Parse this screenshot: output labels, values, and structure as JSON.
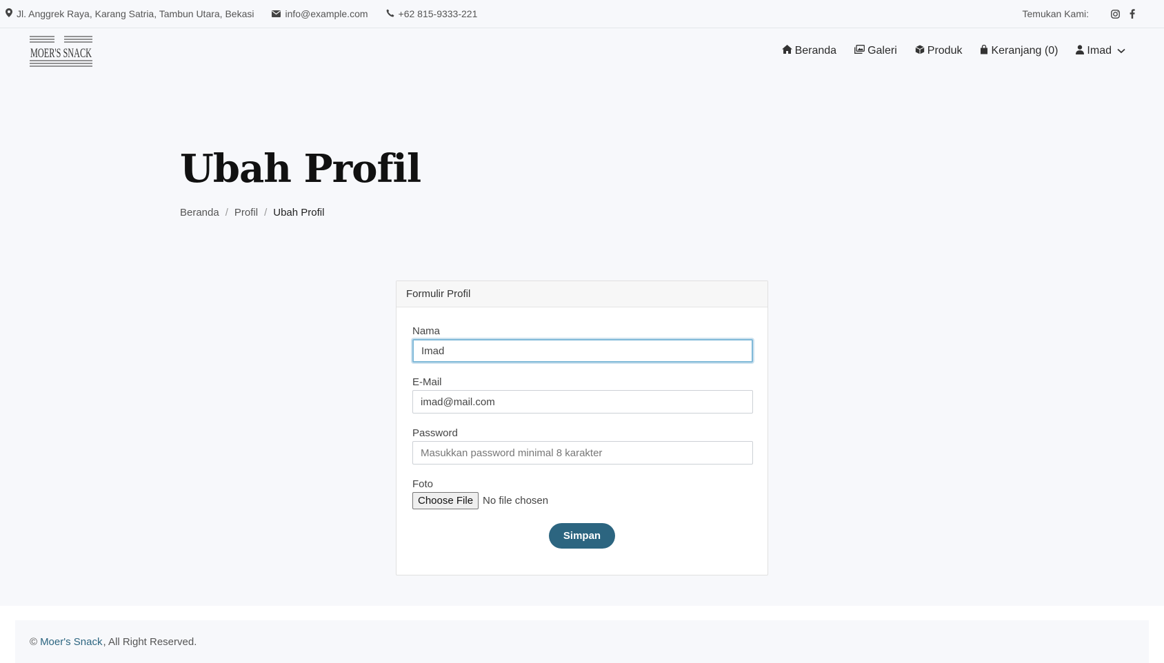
{
  "topbar": {
    "address": "Jl. Anggrek Raya, Karang Satria, Tambun Utara, Bekasi",
    "email": "info@example.com",
    "phone": "+62 815-9333-221",
    "find_us_label": "Temukan Kami:",
    "social_icons": [
      "instagram-icon",
      "facebook-icon"
    ]
  },
  "brand": {
    "logo_text": "MOER'S SNACK"
  },
  "nav": {
    "items": [
      {
        "label": "Beranda",
        "icon": "home-icon"
      },
      {
        "label": "Galeri",
        "icon": "images-icon"
      },
      {
        "label": "Produk",
        "icon": "box-icon"
      },
      {
        "label": "Keranjang (0)",
        "icon": "bag-icon"
      },
      {
        "label": "Imad",
        "icon": "user-icon"
      }
    ]
  },
  "page": {
    "title": "Ubah Profil",
    "breadcrumb": [
      "Beranda",
      "Profil",
      "Ubah Profil"
    ],
    "breadcrumb_separator": "/"
  },
  "form": {
    "card_title": "Formulir Profil",
    "name_label": "Nama",
    "name_value": "Imad",
    "email_label": "E-Mail",
    "email_value": "imad@mail.com",
    "password_label": "Password",
    "password_placeholder": "Masukkan password minimal 8 karakter",
    "photo_label": "Foto",
    "file_button": "Choose File",
    "file_status": "No file chosen",
    "submit_label": "Simpan"
  },
  "footer": {
    "copyright_symbol": "©",
    "brand_link": "Moer's Snack",
    "rights_text": ", All Right Reserved."
  },
  "colors": {
    "accent": "#2c6580",
    "background": "#f7f8fb",
    "focus_ring": "#7fb9d8"
  }
}
